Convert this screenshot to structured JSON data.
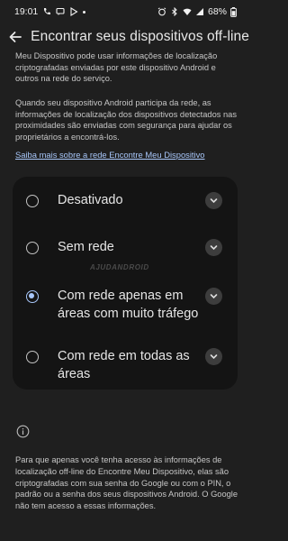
{
  "status_bar": {
    "time": "19:01",
    "battery": "68%"
  },
  "app_bar": {
    "title": "Encontrar seus dispositivos off-line"
  },
  "intro": {
    "paragraph_1": "Meu Dispositivo pode usar informações de localização criptografadas enviadas por este dispositivo Android e outros na rede do serviço.",
    "paragraph_2": "Quando seu dispositivo Android participa da rede, as informações de localização dos dispositivos detectados nas proximidades são enviadas com segurança para ajudar os proprietários a encontrá-los.",
    "learn_more_link": "Saiba mais sobre a rede Encontre Meu Dispositivo"
  },
  "options": [
    {
      "label": "Desativado",
      "selected": false
    },
    {
      "label": "Sem rede",
      "selected": false
    },
    {
      "label": "Com rede apenas em áreas com muito tráfego",
      "selected": true
    },
    {
      "label": "Com rede em todas as áreas",
      "selected": false
    }
  ],
  "watermark": "AJUDANDROID",
  "footer": {
    "text": "Para que apenas você tenha acesso às informações de localização off-line do Encontre Meu Dispositivo, elas são criptografadas com sua senha do Google ou com o PIN, o padrão ou a senha dos seus dispositivos Android. O Google não tem acesso a essas informações."
  },
  "colors": {
    "background": "#1f1f1f",
    "card": "#141414",
    "accent": "#a8c7fa",
    "text": "#e3e3e3"
  }
}
